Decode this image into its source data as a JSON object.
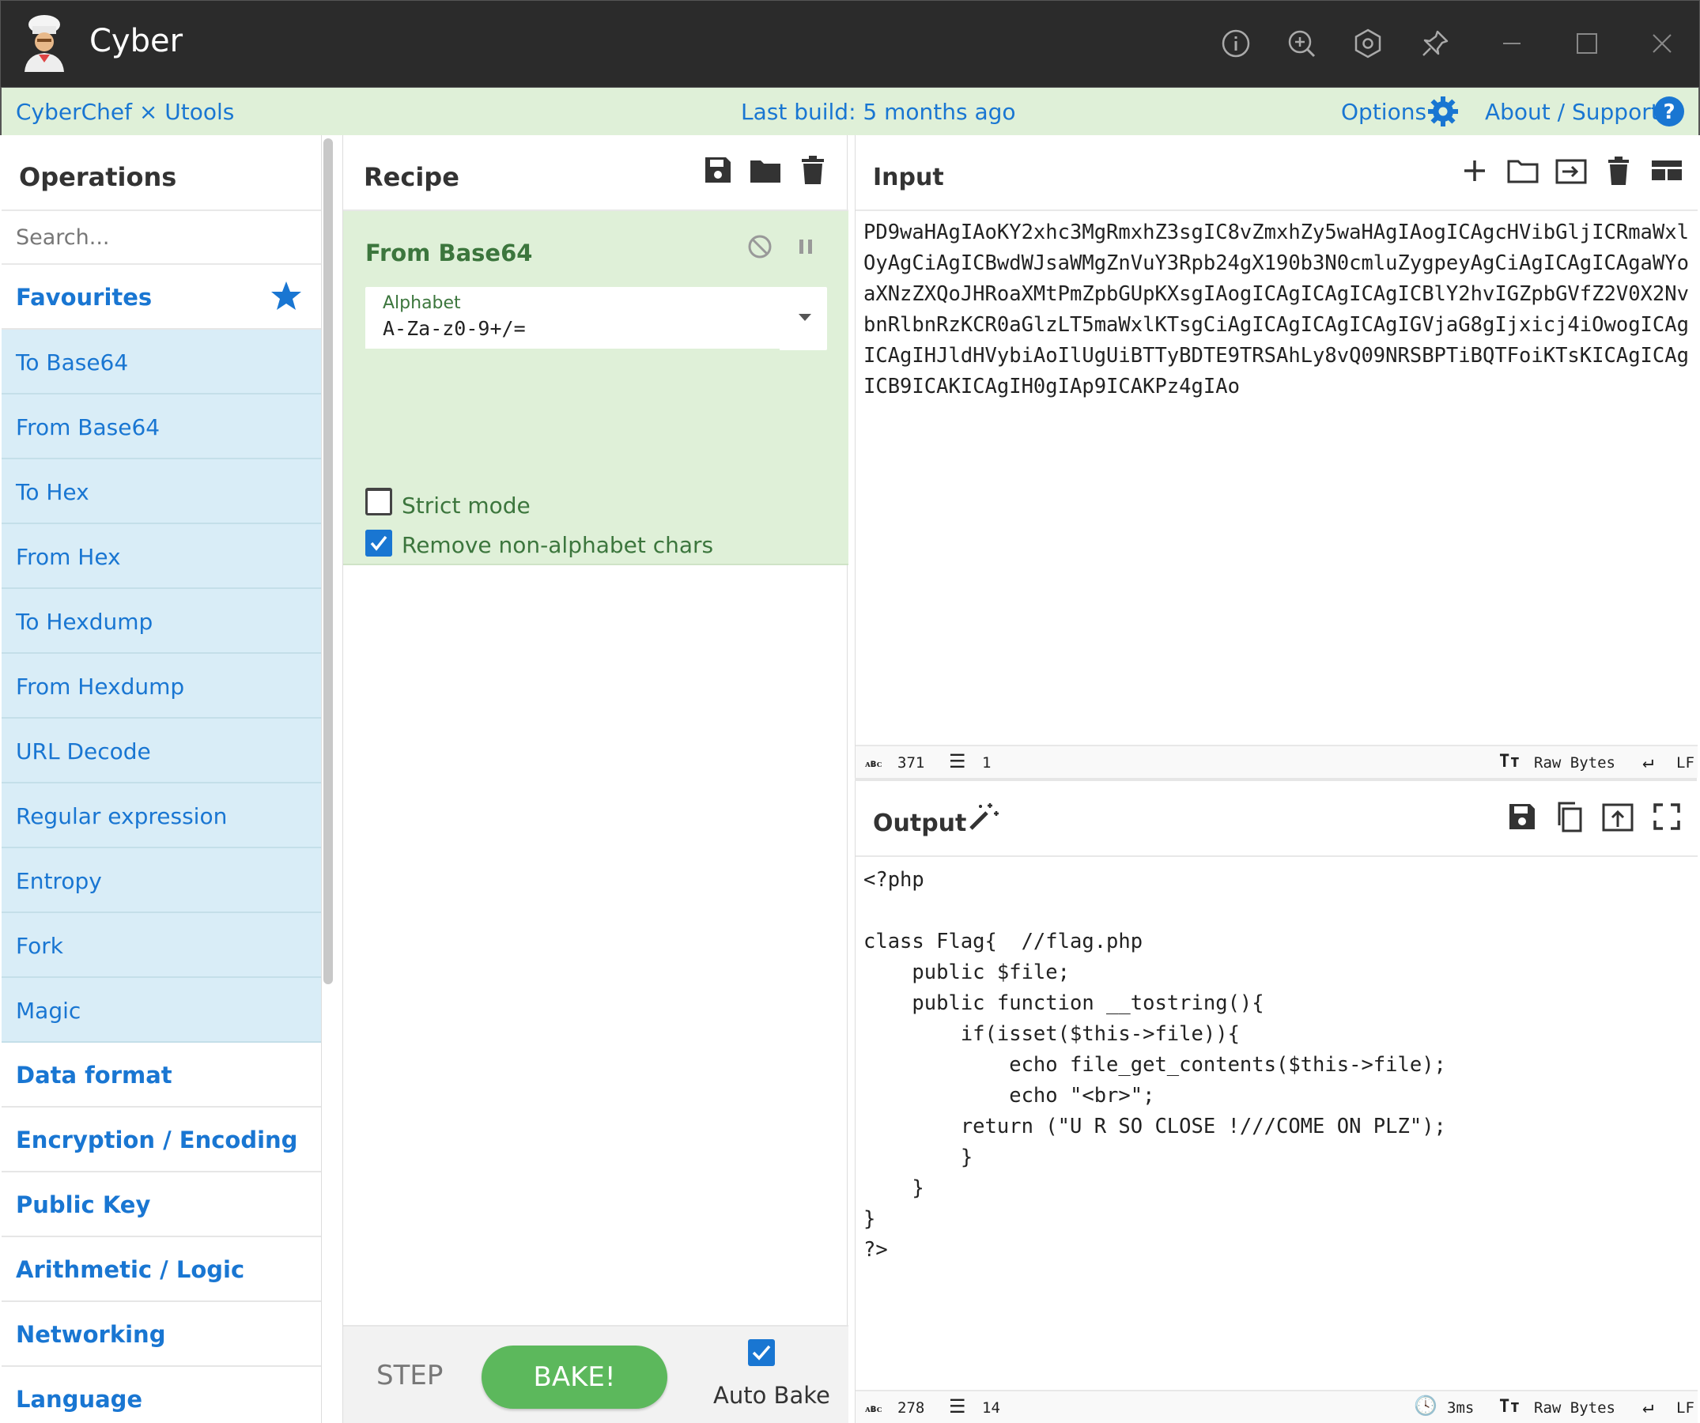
{
  "titlebar": {
    "app_title": "Cyber"
  },
  "banner": {
    "left": "CyberChef × Utools",
    "center": "Last build: 5 months ago",
    "options": "Options",
    "about": "About / Support"
  },
  "operations": {
    "title": "Operations",
    "search_placeholder": "Search...",
    "favourites": "Favourites",
    "items": [
      "To Base64",
      "From Base64",
      "To Hex",
      "From Hex",
      "To Hexdump",
      "From Hexdump",
      "URL Decode",
      "Regular expression",
      "Entropy",
      "Fork",
      "Magic"
    ],
    "categories": [
      "Data format",
      "Encryption / Encoding",
      "Public Key",
      "Arithmetic / Logic",
      "Networking",
      "Language"
    ]
  },
  "recipe": {
    "title": "Recipe",
    "operation": {
      "name": "From Base64",
      "alphabet_label": "Alphabet",
      "alphabet_value": "A-Za-z0-9+/=",
      "remove_non_alpha_label": "Remove non-alphabet chars",
      "remove_non_alpha_checked": true,
      "strict_mode_label": "Strict mode",
      "strict_mode_checked": false
    },
    "step_label": "STEP",
    "bake_label": "BAKE!",
    "auto_bake_label": "Auto Bake",
    "auto_bake_checked": true
  },
  "input": {
    "title": "Input",
    "text": "PD9waHAgIAoKY2xhc3MgRmxhZ3sgIC8vZmxhZy5waHAgIAogICAgcHVibGljICRmaWxlOyAgCiAgICBwdWJsaWMgZnVuY3Rpb24gX190b3N0cmluZygpeyAgCiAgICAgICAgaWYoaXNzZXQoJHRoaXMtPmZpbGUpKXsgIAogICAgICAgICAgICBlY2hvIGZpbGVfZ2V0X2NvbnRlbnRzKCR0aGlzLT5maWxlKTsgCiAgICAgICAgICAgIGVjaG8gIjxicj4iOwogICAgICAgIHJldHVybiAoIlUgUiBTTyBDTE9TRSAhLy8vQ09NRSBPTiBQTFoiKTsKICAgICAgICB9ICAKICAgIH0gIAp9ICAKPz4gIAo",
    "chars": "371",
    "lines": "1",
    "encoding": "Raw Bytes",
    "eol": "LF"
  },
  "output": {
    "title": "Output",
    "text": "<?php\n\nclass Flag{  //flag.php\n    public $file;\n    public function __tostring(){\n        if(isset($this->file)){\n            echo file_get_contents($this->file);\n            echo \"<br>\";\n        return (\"U R SO CLOSE !///COME ON PLZ\");\n        }\n    }\n}\n?>",
    "chars": "278",
    "lines": "14",
    "time": "3ms",
    "encoding": "Raw Bytes",
    "eol": "LF"
  },
  "colors": {
    "accent": "#1976d2",
    "recipe_green": "#dff0d8",
    "bake_green": "#5cb85c",
    "favourite_bg": "#d9edf7"
  }
}
